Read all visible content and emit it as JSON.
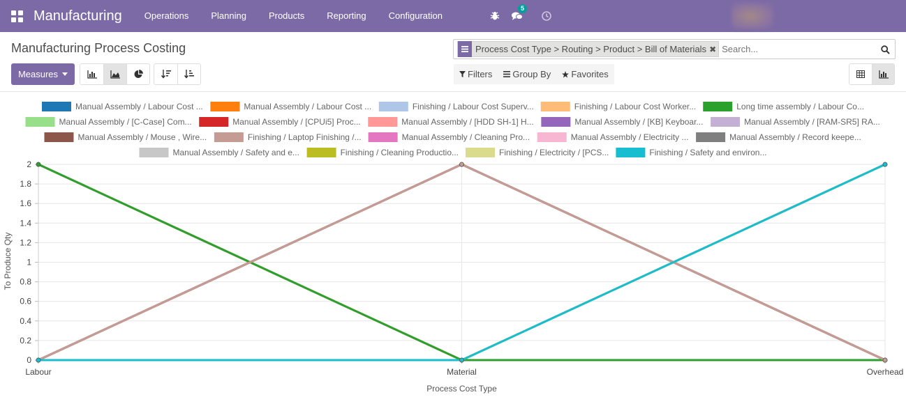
{
  "app": {
    "brand": "Manufacturing",
    "menu": [
      "Operations",
      "Planning",
      "Products",
      "Reporting",
      "Configuration"
    ],
    "messages_badge": "5"
  },
  "page": {
    "title": "Manufacturing Process Costing",
    "facet": "Process Cost Type > Routing > Product > Bill of Materials",
    "search_placeholder": "Search...",
    "measures_label": "Measures",
    "filters_label": "Filters",
    "groupby_label": "Group By",
    "favorites_label": "Favorites"
  },
  "chart_data": {
    "type": "line",
    "x": [
      "Labour",
      "Material",
      "Overhead"
    ],
    "xlabel": "Process Cost Type",
    "ylabel": "To Produce Qty",
    "ylim": [
      0,
      2
    ],
    "yticks": [
      "0",
      "0.2",
      "0.4",
      "0.6",
      "0.8",
      "1",
      "1.2",
      "1.4",
      "1.6",
      "1.8",
      "2"
    ],
    "grid": true,
    "legend_position": "top",
    "series": [
      {
        "name": "Manual Assembly / Labour Cost ...",
        "color": "#1f77b4",
        "values": [
          2,
          0,
          0
        ]
      },
      {
        "name": "Manual Assembly / Labour Cost ...",
        "color": "#ff7f0e",
        "values": [
          2,
          0,
          0
        ]
      },
      {
        "name": "Finishing / Labour Cost Superv...",
        "color": "#aec7e8",
        "values": [
          2,
          0,
          0
        ]
      },
      {
        "name": "Finishing / Labour Cost Worker...",
        "color": "#ffbb78",
        "values": [
          2,
          0,
          0
        ]
      },
      {
        "name": "Long time assembly / Labour Co...",
        "color": "#2ca02c",
        "values": [
          2,
          0,
          0
        ]
      },
      {
        "name": "Manual Assembly / [C-Case] Com...",
        "color": "#98df8a",
        "values": [
          0,
          2,
          0
        ]
      },
      {
        "name": "Manual Assembly / [CPUi5] Proc...",
        "color": "#d62728",
        "values": [
          0,
          2,
          0
        ]
      },
      {
        "name": "Manual Assembly / [HDD SH-1] H...",
        "color": "#ff9896",
        "values": [
          0,
          2,
          0
        ]
      },
      {
        "name": "Manual Assembly / [KB] Keyboar...",
        "color": "#9467bd",
        "values": [
          0,
          2,
          0
        ]
      },
      {
        "name": "Manual Assembly / [RAM-SR5] RA...",
        "color": "#c5b0d5",
        "values": [
          0,
          2,
          0
        ]
      },
      {
        "name": "Manual Assembly / Mouse , Wire...",
        "color": "#8c564b",
        "values": [
          0,
          2,
          0
        ]
      },
      {
        "name": "Finishing / Laptop Finishing /...",
        "color": "#c49c94",
        "values": [
          0,
          2,
          0
        ]
      },
      {
        "name": "Manual Assembly / Cleaning Pro...",
        "color": "#e377c2",
        "values": [
          0,
          0,
          2
        ]
      },
      {
        "name": "Manual Assembly / Electricity ...",
        "color": "#f7b6d2",
        "values": [
          0,
          0,
          2
        ]
      },
      {
        "name": "Manual Assembly / Record keepe...",
        "color": "#7f7f7f",
        "values": [
          0,
          0,
          2
        ]
      },
      {
        "name": "Manual Assembly / Safety and e...",
        "color": "#c7c7c7",
        "values": [
          0,
          0,
          2
        ]
      },
      {
        "name": "Finishing / Cleaning Productio...",
        "color": "#bcbd22",
        "values": [
          0,
          0,
          2
        ]
      },
      {
        "name": "Finishing / Electricity / [PCS...",
        "color": "#dbdb8d",
        "values": [
          0,
          0,
          2
        ]
      },
      {
        "name": "Finishing / Safety and environ...",
        "color": "#17becf",
        "values": [
          0,
          0,
          2
        ]
      }
    ],
    "draw_order_note": "",
    "legend_rows": [
      [
        0,
        1,
        2,
        3,
        4
      ],
      [
        5,
        6,
        7,
        8,
        9
      ],
      [
        10,
        11,
        12,
        13,
        14
      ],
      [
        15,
        16,
        17,
        18
      ]
    ]
  }
}
